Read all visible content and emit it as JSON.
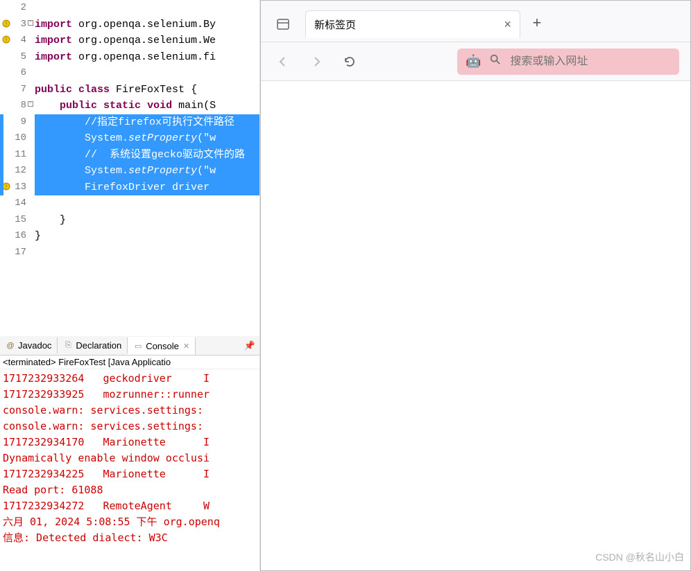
{
  "code": {
    "lines": [
      {
        "n": 2,
        "plain": ""
      },
      {
        "n": 3,
        "kw": "import",
        "rest": " org.openqa.selenium.By",
        "fold": true,
        "marker": true
      },
      {
        "n": 4,
        "kw": "import",
        "rest": " org.openqa.selenium.We",
        "marker": true
      },
      {
        "n": 5,
        "kw": "import",
        "rest": " org.openqa.selenium.fi"
      },
      {
        "n": 6,
        "plain": ""
      },
      {
        "n": 7,
        "sig": true
      },
      {
        "n": 8,
        "main": true,
        "fold": true
      },
      {
        "n": 9,
        "sel": true,
        "type": "comment",
        "text": "//指定firefox可执行文件路径"
      },
      {
        "n": 10,
        "sel": true,
        "type": "setprop",
        "prefix": "System.",
        "method": "setProperty",
        "after": "(\"w"
      },
      {
        "n": 11,
        "sel": true,
        "type": "comment",
        "text": "//  系统设置gecko驱动文件的路"
      },
      {
        "n": 12,
        "sel": true,
        "type": "setprop",
        "prefix": "System.",
        "method": "setProperty",
        "after": "(\"w"
      },
      {
        "n": 13,
        "sel": true,
        "type": "driver",
        "text": "FirefoxDriver driver ",
        "marker": true
      },
      {
        "n": 14,
        "plain": ""
      },
      {
        "n": 15,
        "closebrace": "    }"
      },
      {
        "n": 16,
        "closebrace": "}"
      },
      {
        "n": 17,
        "plain": ""
      }
    ],
    "sig_kw1": "public",
    "sig_kw2": "class",
    "sig_name": "FireFoxTest {",
    "main_kw1": "public",
    "main_kw2": "static",
    "main_kw3": "void",
    "main_name": "main(S"
  },
  "tabs": {
    "javadoc": "Javadoc",
    "declaration": "Declaration",
    "console": "Console"
  },
  "console": {
    "status": "<terminated> FireFoxTest [Java Applicatio",
    "lines": [
      "1717232933264   geckodriver     I",
      "1717232933925   mozrunner::runner",
      "console.warn: services.settings: ",
      "console.warn: services.settings: ",
      "1717232934170   Marionette      I",
      "Dynamically enable window occlusi",
      "1717232934225   Marionette      I",
      "Read port: 61088",
      "1717232934272   RemoteAgent     W",
      "六月 01, 2024 5:08:55 下午 org.openq",
      "信息: Detected dialect: W3C"
    ]
  },
  "browser": {
    "tab_title": "新标签页",
    "url_placeholder": "搜索或输入网址"
  },
  "watermark": "CSDN @秋名山小白"
}
